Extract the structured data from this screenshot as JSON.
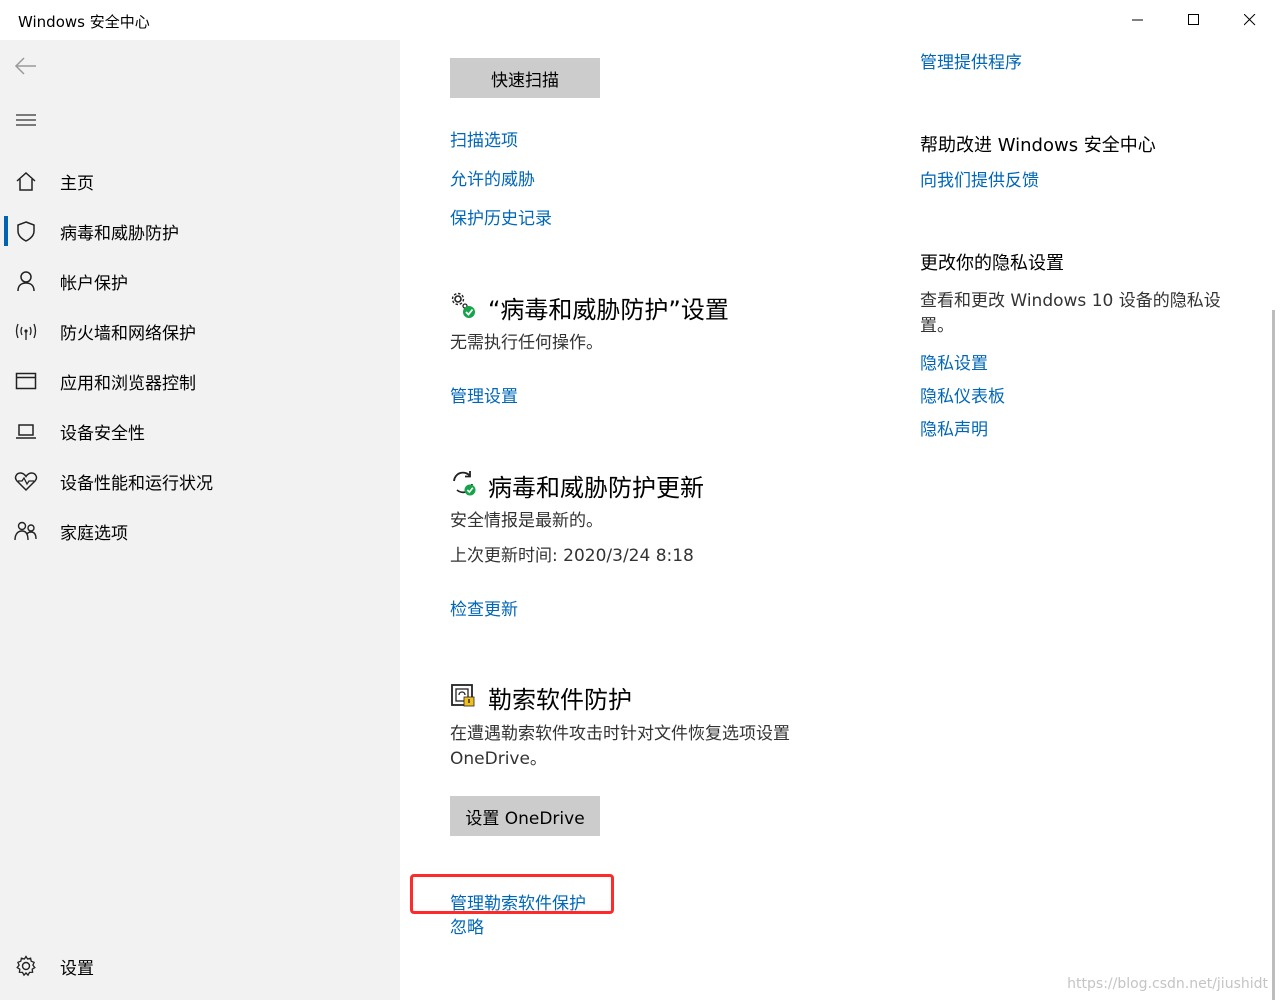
{
  "window": {
    "title": "Windows 安全中心",
    "controls": [
      "minimize",
      "maximize",
      "close"
    ]
  },
  "sidebar": {
    "items": [
      {
        "label": "主页",
        "icon": "home-icon"
      },
      {
        "label": "病毒和威胁防护",
        "icon": "shield-icon",
        "active": true
      },
      {
        "label": "帐户保护",
        "icon": "person-icon"
      },
      {
        "label": "防火墙和网络保护",
        "icon": "wifi-icon"
      },
      {
        "label": "应用和浏览器控制",
        "icon": "app-window-icon"
      },
      {
        "label": "设备安全性",
        "icon": "laptop-icon"
      },
      {
        "label": "设备性能和运行状况",
        "icon": "heart-icon"
      },
      {
        "label": "家庭选项",
        "icon": "family-icon"
      }
    ],
    "settings_label": "设置"
  },
  "main": {
    "quick_scan_button": "快速扫描",
    "scan_links": [
      "扫描选项",
      "允许的威胁",
      "保护历史记录"
    ],
    "settings_section": {
      "title": "“病毒和威胁防护”设置",
      "status": "无需执行任何操作。",
      "link": "管理设置"
    },
    "updates_section": {
      "title": "病毒和威胁防护更新",
      "status": "安全情报是最新的。",
      "last_update": "上次更新时间: 2020/3/24 8:18",
      "link": "检查更新"
    },
    "ransomware_section": {
      "title": "勒索软件防护",
      "description": "在遭遇勒索软件攻击时针对文件恢复选项设置 OneDrive。",
      "button": "设置 OneDrive",
      "link_manage": "管理勒索软件保护",
      "link_dismiss": "忽略"
    }
  },
  "right_panel": {
    "providers_link": "管理提供程序",
    "improve_title": "帮助改进 Windows 安全中心",
    "feedback_link": "向我们提供反馈",
    "privacy_title": "更改你的隐私设置",
    "privacy_desc": "查看和更改 Windows 10 设备的隐私设置。",
    "privacy_links": [
      "隐私设置",
      "隐私仪表板",
      "隐私声明"
    ]
  },
  "watermark": "https://blog.csdn.net/jiushidt",
  "colors": {
    "link": "#0067b8",
    "accent": "#0063b1",
    "highlight": "#ff2a2a"
  }
}
